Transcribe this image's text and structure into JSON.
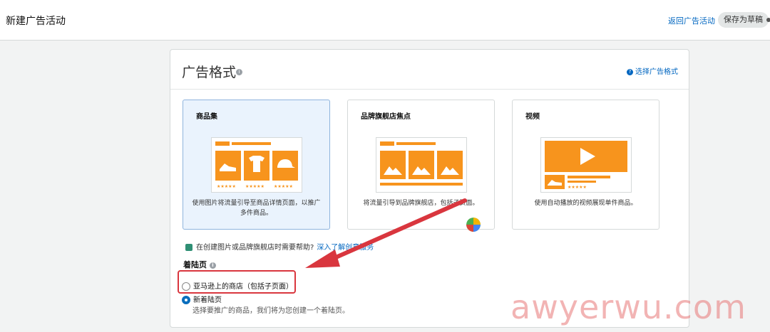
{
  "header": {
    "title": "新建广告活动",
    "back_label": "返回广告活动",
    "save_label": "保存为草稿"
  },
  "panel": {
    "title": "广告格式",
    "choose_label": "选择广告格式"
  },
  "cards": [
    {
      "title": "商品集",
      "desc": "使用图片将流量引导至商品详情页面，以推广多件商品。",
      "selected": true
    },
    {
      "title": "品牌旗舰店焦点",
      "desc": "将流量引导到品牌旗舰店，包括子页面。",
      "selected": false
    },
    {
      "title": "视频",
      "desc": "使用自动播放的视频展现单件商品。",
      "selected": false
    }
  ],
  "help": {
    "text": "在创建图片或品牌旗舰店时需要帮助?",
    "link": "深入了解创意服务"
  },
  "landing": {
    "label": "着陆页",
    "options": [
      {
        "label": "亚马逊上的商店（包括子页面）",
        "checked": false
      },
      {
        "label": "新着陆页",
        "checked": true
      }
    ],
    "sub_text": "选择要推广的商品，我们将为您创建一个着陆页。"
  },
  "watermark": "awyerwu.com",
  "colors": {
    "accent": "#0066c0",
    "orange": "#f7941d",
    "annotation": "#d9363e"
  }
}
